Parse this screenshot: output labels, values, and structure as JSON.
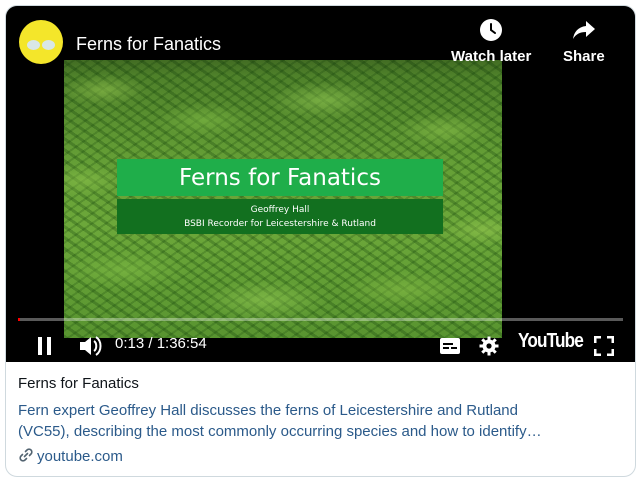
{
  "player": {
    "channel_avatar": "channel-avatar",
    "video_title": "Ferns for Fanatics",
    "watch_later_label": "Watch later",
    "share_label": "Share",
    "slide": {
      "title": "Ferns for Fanatics",
      "line1": "Geoffrey Hall",
      "line2": "BSBI Recorder for Leicestershire & Rutland"
    },
    "time_display": "0:13 / 1:36:54",
    "progress_fraction": 0.0023,
    "brand_label": "YouTube",
    "icons": [
      "clock-icon",
      "share-arrow-icon",
      "pause-icon",
      "volume-icon",
      "captions-icon",
      "settings-gear-icon",
      "fullscreen-icon"
    ],
    "colors": {
      "progress": "#ff0000",
      "slide_title_band": "#1fae4a",
      "slide_sub_band": "#12701f"
    }
  },
  "card": {
    "title": "Ferns for Fanatics",
    "description_line1": "Fern expert Geoffrey Hall discusses the ferns of Leicestershire and Rutland",
    "description_line2": "(VC55), describing the most commonly occurring species and how to identify…",
    "link_icon": "link-icon",
    "domain": "youtube.com",
    "colors": {
      "link": "#2b5a8a",
      "title": "#0f1419",
      "border": "#cfd9de"
    }
  }
}
